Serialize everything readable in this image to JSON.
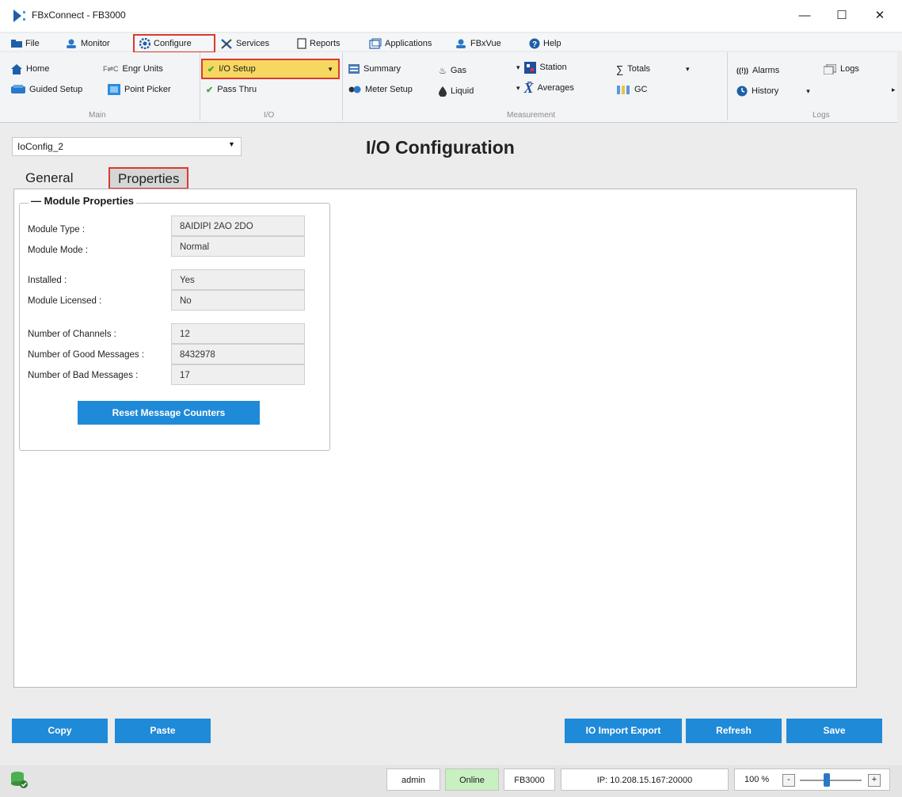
{
  "window": {
    "title": "FBxConnect - FB3000",
    "minimize": "—",
    "maximize": "☐",
    "close": "✕"
  },
  "menu": {
    "items": [
      {
        "label": "File",
        "icon": "folder-icon"
      },
      {
        "label": "Monitor",
        "icon": "user-icon"
      },
      {
        "label": "Configure",
        "icon": "gear-icon"
      },
      {
        "label": "Services",
        "icon": "wrench-icon"
      },
      {
        "label": "Reports",
        "icon": "document-icon"
      },
      {
        "label": "Applications",
        "icon": "window-icon"
      },
      {
        "label": "FBxVue",
        "icon": "user-icon"
      },
      {
        "label": "Help",
        "icon": "help-icon"
      }
    ]
  },
  "ribbon": {
    "main": {
      "home": "Home",
      "guided_setup": "Guided Setup",
      "engr_units": "Engr Units",
      "engr_units_prefix": "F⇌C",
      "point_picker": "Point Picker",
      "group": "Main"
    },
    "io": {
      "io_setup": "I/O Setup",
      "pass_thru": "Pass Thru",
      "group": "I/O"
    },
    "measurement": {
      "summary": "Summary",
      "meter_setup": "Meter Setup",
      "gas": "Gas",
      "liquid": "Liquid",
      "station": "Station",
      "averages": "Averages",
      "averages_symbol": "X̄",
      "totals": "Totals",
      "totals_symbol": "∑",
      "gc": "GC",
      "group": "Measurement"
    },
    "logs": {
      "alarms": "Alarms",
      "alarms_symbol": "((!))",
      "history": "History",
      "logs": "Logs",
      "group": "Logs"
    }
  },
  "config_select": {
    "value": "IoConfig_2"
  },
  "page_title": "I/O Configuration",
  "tabs": [
    {
      "label": "General"
    },
    {
      "label": "Properties"
    }
  ],
  "module": {
    "group_title": "Module Properties",
    "rows": [
      {
        "label": "Module Type :",
        "value": "8AIDIPI 2AO 2DO"
      },
      {
        "label": "Module Mode :",
        "value": "Normal"
      },
      {
        "label": "Installed :",
        "value": "Yes"
      },
      {
        "label": "Module Licensed :",
        "value": "No"
      },
      {
        "label": "Number of Channels :",
        "value": "12"
      },
      {
        "label": "Number of Good Messages :",
        "value": "8432978"
      },
      {
        "label": "Number of Bad Messages :",
        "value": "17"
      }
    ],
    "reset_button": "Reset Message Counters"
  },
  "footer_buttons": {
    "copy": "Copy",
    "paste": "Paste",
    "io_import_export": "IO Import Export",
    "refresh": "Refresh",
    "save": "Save"
  },
  "status": {
    "user": "admin",
    "connection": "Online",
    "device": "FB3000",
    "ip": "IP: 10.208.15.167:20000",
    "zoom": "100 %",
    "zoom_minus": "-",
    "zoom_plus": "+"
  },
  "colors": {
    "accent": "#1f8ad8",
    "highlight_border": "#d93a2f",
    "online": "#c8f0c0",
    "io_setup_bg": "#f6d860"
  }
}
